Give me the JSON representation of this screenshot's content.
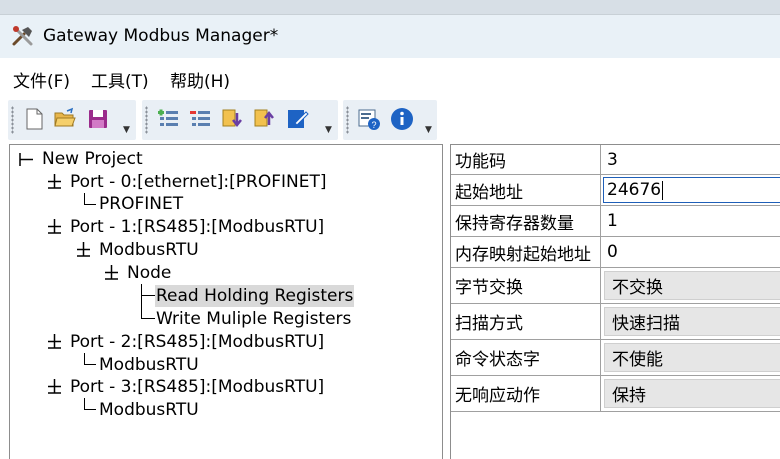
{
  "window": {
    "title": "Gateway Modbus Manager*",
    "icon": "tools-icon"
  },
  "menu": {
    "items": [
      {
        "label": "文件(F)"
      },
      {
        "label": "工具(T)"
      },
      {
        "label": "帮助(H)"
      }
    ]
  },
  "toolbar": {
    "groups": [
      [
        "new-file-icon",
        "open-folder-icon",
        "save-icon"
      ],
      [
        "add-list-icon",
        "remove-list-icon",
        "download-icon",
        "upload-icon",
        "edit-icon"
      ],
      [
        "settings-help-icon",
        "info-icon"
      ]
    ]
  },
  "tree": {
    "root": "New Project",
    "port0": "Port - 0:[ethernet]:[PROFINET]",
    "port0_child": "PROFINET",
    "port1": "Port - 1:[RS485]:[ModbusRTU]",
    "port1_child": "ModbusRTU",
    "node": "Node",
    "cmd1": "Read Holding Registers",
    "cmd2": "Write Muliple Registers",
    "port2": "Port - 2:[RS485]:[ModbusRTU]",
    "port2_child": "ModbusRTU",
    "port3": "Port - 3:[RS485]:[ModbusRTU]",
    "port3_child": "ModbusRTU",
    "selected": "Read Holding Registers"
  },
  "properties": [
    {
      "name": "功能码",
      "value": "3"
    },
    {
      "name": "起始地址",
      "value": "24676"
    },
    {
      "name": "保持寄存器数量",
      "value": "1"
    },
    {
      "name": "内存映射起始地址",
      "value": "0"
    },
    {
      "name": "字节交换",
      "value": "不交换"
    },
    {
      "name": "扫描方式",
      "value": "快速扫描"
    },
    {
      "name": "命令状态字",
      "value": "不使能"
    },
    {
      "name": "无响应动作",
      "value": "保持"
    }
  ],
  "colors": {
    "titlebar": "#e9f1f7",
    "toolbar_group": "#e9eff5",
    "selection": "#d9d9d9",
    "edit_border": "#1f5fb8",
    "combo": "#e6e6e6"
  }
}
